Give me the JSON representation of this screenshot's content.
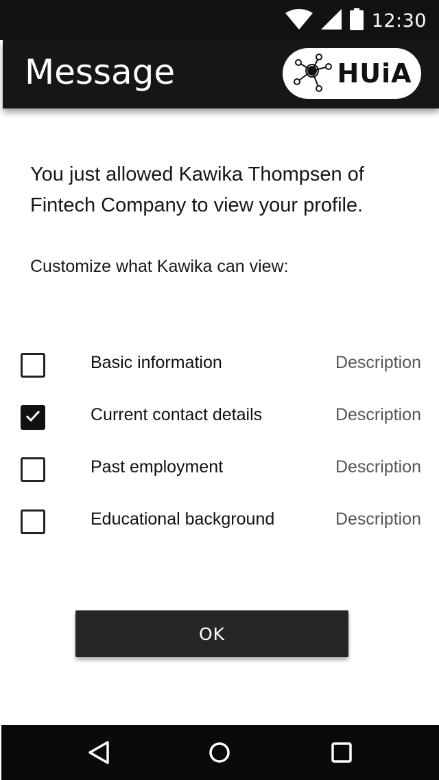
{
  "status_bar": {
    "time": "12:30",
    "icons": [
      "wifi-icon",
      "signal-icon",
      "battery-icon"
    ]
  },
  "app_bar": {
    "title": "Message",
    "logo_text": "HUiA",
    "logo_icon": "network-node-icon"
  },
  "content": {
    "intro_text": "You just allowed Kawika Thompsen of Fintech Company to view your profile.",
    "customize_label": "Customize what Kawika can view:",
    "options": [
      {
        "label": "Basic information",
        "description": "Description",
        "checked": false
      },
      {
        "label": "Current contact details",
        "description": "Description",
        "checked": true
      },
      {
        "label": "Past employment",
        "description": "Description",
        "checked": false
      },
      {
        "label": "Educational background",
        "description": "Description",
        "checked": false
      }
    ],
    "ok_label": "OK"
  },
  "nav_bar": {
    "icons": [
      "back-icon",
      "home-icon",
      "recents-icon"
    ]
  },
  "colors": {
    "bar_background": "#161616",
    "button_background": "#262626",
    "text_primary": "#111111",
    "text_secondary": "#555555"
  }
}
